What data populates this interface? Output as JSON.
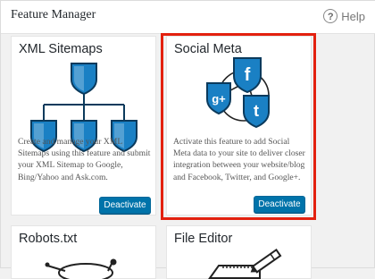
{
  "panel": {
    "title": "Feature Manager",
    "help_label": "Help",
    "help_glyph": "?"
  },
  "cards": [
    {
      "title": "XML Sitemaps",
      "description": "Create and manage your XML Sitemaps using this feature and submit your XML Sitemap to Google, Bing/Yahoo and Ask.com.",
      "button_label": "Deactivate",
      "icon": "sitemap-tree-icon"
    },
    {
      "title": "Social Meta",
      "description": "Activate this feature to add Social Meta data to your site to deliver closer integration between your website/blog and Facebook, Twitter, and Google+.",
      "button_label": "Deactivate",
      "icon": "social-shields-icon",
      "highlighted": true
    },
    {
      "title": "Robots.txt",
      "icon": "robot-icon"
    },
    {
      "title": "File Editor",
      "icon": "file-editor-icon"
    }
  ],
  "icon_glyphs": {
    "facebook": "f",
    "google_plus": "g+",
    "twitter": "t"
  },
  "colors": {
    "primary_button": "#0073aa",
    "highlight": "#e3210f",
    "shield_blue": "#0d6fa8"
  }
}
